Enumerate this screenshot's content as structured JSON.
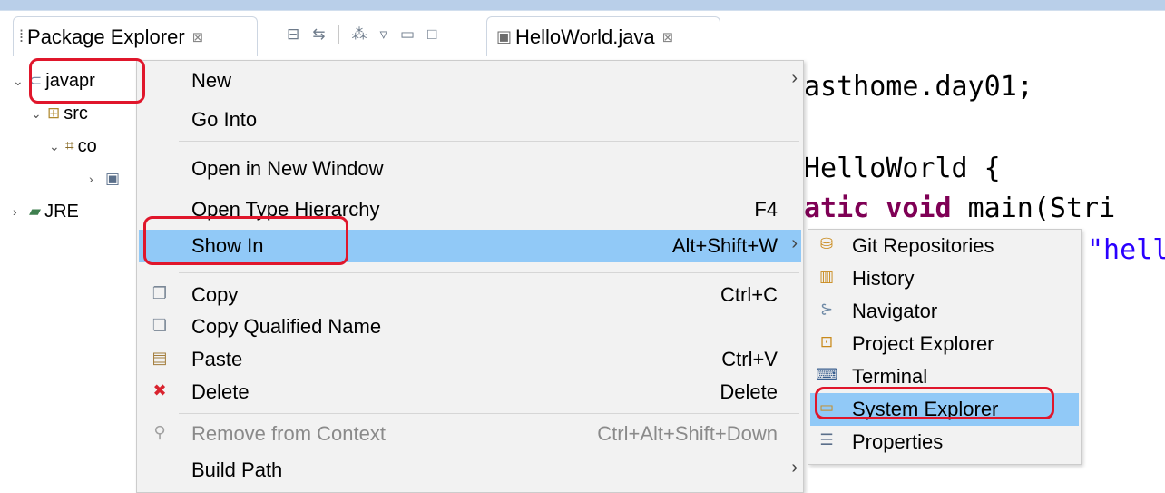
{
  "package_explorer": {
    "tab_title": "Package Explorer",
    "tab_icon": "package-explorer-icon",
    "close_glyph": "⊠",
    "tree": [
      {
        "label": "javapr",
        "icon": "project-folder-icon"
      },
      {
        "label": "src",
        "icon": "source-folder-icon"
      },
      {
        "label": "co",
        "icon": "package-icon"
      },
      {
        "label": "",
        "icon": "java-file-icon"
      },
      {
        "label": "JRE",
        "icon": "library-icon"
      }
    ]
  },
  "editor": {
    "tab_title": "HelloWorld.java",
    "tab_icon": "java-file-icon",
    "close_glyph": "⊠",
    "code": {
      "line1": "asthome.day01;",
      "line2": "HelloWorld {",
      "line3_kw": "atic void",
      "line3_rest": " main(Stri",
      "line4": "\"hell"
    }
  },
  "context_menu": {
    "new": {
      "label": "New"
    },
    "go_into": {
      "label": "Go Into"
    },
    "open_new_window": {
      "label": "Open in New Window"
    },
    "open_type_hierarchy": {
      "label": "Open Type Hierarchy",
      "shortcut": "F4"
    },
    "show_in": {
      "label": "Show In",
      "shortcut": "Alt+Shift+W"
    },
    "copy": {
      "label": "Copy",
      "shortcut": "Ctrl+C",
      "icon": "copy-icon"
    },
    "copy_qualified_name": {
      "label": "Copy Qualified Name",
      "icon": "copy-qualified-name-icon"
    },
    "paste": {
      "label": "Paste",
      "shortcut": "Ctrl+V",
      "icon": "paste-icon"
    },
    "delete": {
      "label": "Delete",
      "shortcut": "Delete",
      "icon": "delete-icon"
    },
    "remove_from_context": {
      "label": "Remove from Context",
      "shortcut": "Ctrl+Alt+Shift+Down",
      "icon": "remove-context-icon"
    },
    "build_path": {
      "label": "Build Path"
    }
  },
  "show_in_submenu": [
    {
      "label": "Git Repositories",
      "icon": "git-repositories-icon"
    },
    {
      "label": "History",
      "icon": "history-icon"
    },
    {
      "label": "Navigator",
      "icon": "navigator-icon"
    },
    {
      "label": "Project Explorer",
      "icon": "project-explorer-icon"
    },
    {
      "label": "Terminal",
      "icon": "terminal-icon"
    },
    {
      "label": "System Explorer",
      "icon": "system-explorer-icon"
    },
    {
      "label": "Properties",
      "icon": "properties-icon"
    }
  ],
  "colors": {
    "menu_background": "#f2f2f2",
    "highlight": "#91c9f7",
    "annotation_red": "#e0162b",
    "keyword": "#7f0055",
    "string": "#2a00ff"
  }
}
